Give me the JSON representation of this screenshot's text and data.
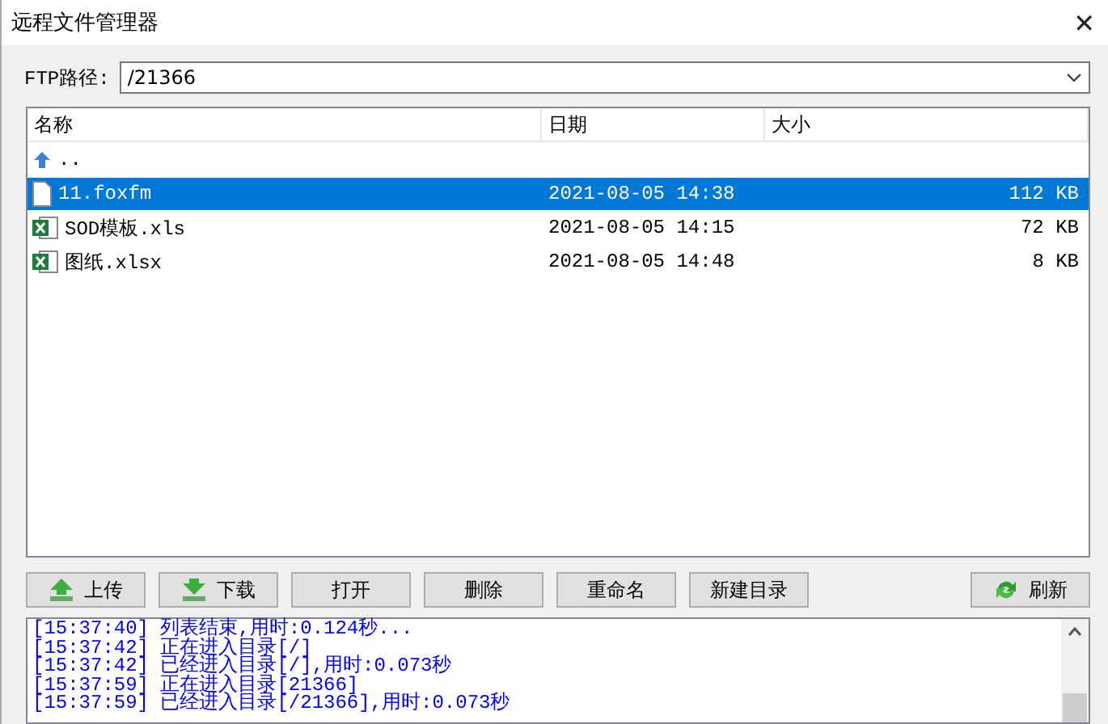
{
  "window": {
    "title": "远程文件管理器",
    "close": "✕"
  },
  "path": {
    "label": "FTP路径:",
    "value": "/21366"
  },
  "table": {
    "columns": [
      "名称",
      "日期",
      "大小"
    ],
    "rows": [
      {
        "kind": "up",
        "name": "..",
        "date": "",
        "size": "",
        "selected": false
      },
      {
        "kind": "file",
        "name": "11.foxfm",
        "date": "2021-08-05 14:38",
        "size": "112 KB",
        "selected": true
      },
      {
        "kind": "excel",
        "name": "SOD模板.xls",
        "date": "2021-08-05 14:15",
        "size": "72 KB",
        "selected": false
      },
      {
        "kind": "excel",
        "name": "图纸.xlsx",
        "date": "2021-08-05 14:48",
        "size": "8 KB",
        "selected": false
      }
    ]
  },
  "buttons": [
    {
      "label": "上传",
      "kind": "upload"
    },
    {
      "label": "下载",
      "kind": "download"
    },
    {
      "label": "打开",
      "kind": "plain"
    },
    {
      "label": "删除",
      "kind": "plain"
    },
    {
      "label": "重命名",
      "kind": "plain"
    },
    {
      "label": "新建目录",
      "kind": "plain"
    },
    {
      "label": "刷新",
      "kind": "refresh"
    }
  ],
  "log": [
    "[15:37:40] 列表结束,用时:0.124秒...",
    "[15:37:42] 正在进入目录[/]",
    "[15:37:42] 已经进入目录[/],用时:0.073秒",
    "[15:37:59] 正在进入目录[21366]",
    "[15:37:59] 已经进入目录[/21366],用时:0.073秒"
  ]
}
